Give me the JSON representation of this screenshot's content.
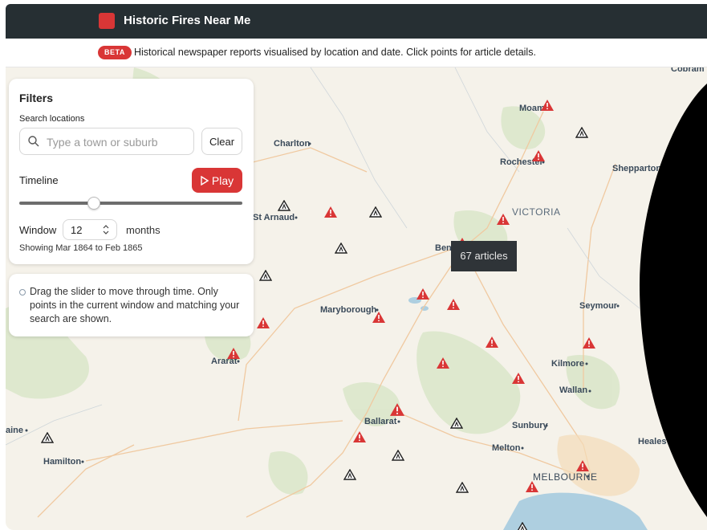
{
  "header": {
    "title": "Historic Fires Near Me"
  },
  "subheader": {
    "badge": "BETA",
    "text": "Historical newspaper reports visualised by location and date. Click points for article details."
  },
  "filters": {
    "title": "Filters",
    "search_label": "Search locations",
    "search_placeholder": "Type a town or suburb",
    "search_value": "",
    "clear_label": "Clear",
    "timeline_label": "Timeline",
    "play_label": "Play",
    "slider_position": 0.33,
    "window_label": "Window",
    "window_value": "12",
    "window_unit": "months",
    "showing_text": "Showing Mar 1864 to Feb 1865"
  },
  "help": {
    "text": "Drag the slider to move through time. Only points in the current window and matching your search are shown."
  },
  "tooltip": {
    "text": "67 articles"
  },
  "map": {
    "places": [
      {
        "name": "Moama"
      },
      {
        "name": "Cobram"
      },
      {
        "name": "Charlton"
      },
      {
        "name": "Rochester"
      },
      {
        "name": "Shepparton"
      },
      {
        "name": "St Arnaud"
      },
      {
        "name": "VICTORIA"
      },
      {
        "name": "Bendigo"
      },
      {
        "name": "Maryborough"
      },
      {
        "name": "Seymour"
      },
      {
        "name": "Ararat"
      },
      {
        "name": "Kilmore"
      },
      {
        "name": "Wallan"
      },
      {
        "name": "Ballarat"
      },
      {
        "name": "Sunbury"
      },
      {
        "name": "aine"
      },
      {
        "name": "Healesv"
      },
      {
        "name": "Melton"
      },
      {
        "name": "Hamilton"
      },
      {
        "name": "MELBOURNE"
      }
    ],
    "colors": {
      "alert": "#d93636",
      "land": "#f5f2ea",
      "water": "#aecfe0"
    }
  }
}
